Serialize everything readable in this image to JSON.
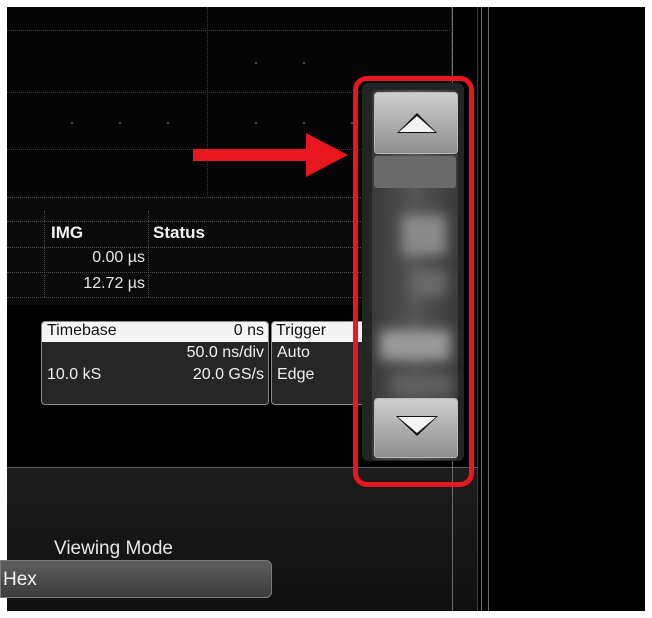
{
  "measure_table": {
    "headers": {
      "col1": "IMG",
      "col2": "Status"
    },
    "rows": [
      {
        "value": "0.00 µs"
      },
      {
        "value": "12.72 µs"
      }
    ]
  },
  "timebase": {
    "title": "Timebase",
    "delay": "0 ns",
    "scale": "50.0 ns/div",
    "samples": "10.0 kS",
    "sample_rate": "20.0 GS/s"
  },
  "trigger": {
    "title": "Trigger",
    "mode": "Auto",
    "type": "Edge"
  },
  "viewing_mode": {
    "label": "Viewing Mode",
    "value": "Hex"
  },
  "scroll_control": {
    "up_icon": "triangle-up-icon",
    "down_icon": "triangle-down-icon"
  },
  "annotation": {
    "color": "#e8161f"
  }
}
